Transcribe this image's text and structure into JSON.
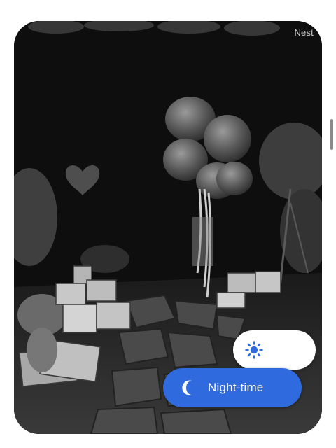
{
  "camera": {
    "brand": "Nest"
  },
  "controls": {
    "day_mode_icon": "sun-icon",
    "night_mode_icon": "moon-icon",
    "night_label": "Night-time",
    "accent_color": "#2f6bde"
  }
}
